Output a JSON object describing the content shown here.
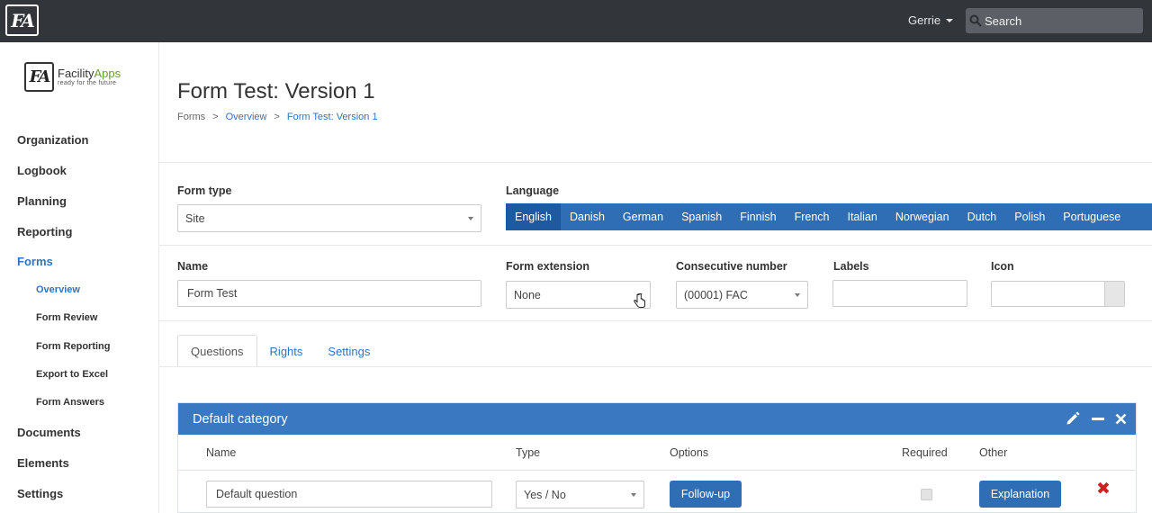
{
  "topbar": {
    "logo_text": "FA",
    "user_name": "Gerrie",
    "search_placeholder": "Search"
  },
  "brand": {
    "mark": "FA",
    "name_part1": "Facility",
    "name_part2": "Apps",
    "tagline": "ready for the future"
  },
  "sidebar": {
    "items": [
      {
        "label": "Organization"
      },
      {
        "label": "Logbook"
      },
      {
        "label": "Planning"
      },
      {
        "label": "Reporting"
      },
      {
        "label": "Forms"
      },
      {
        "label": "Documents"
      },
      {
        "label": "Elements"
      },
      {
        "label": "Settings"
      }
    ],
    "sub_items": [
      {
        "label": "Overview"
      },
      {
        "label": "Form Review"
      },
      {
        "label": "Form Reporting"
      },
      {
        "label": "Export to Excel"
      },
      {
        "label": "Form Answers"
      }
    ]
  },
  "page": {
    "title": "Form Test: Version 1",
    "breadcrumb": [
      "Forms",
      ">",
      "Overview",
      ">",
      "Form Test: Version 1"
    ]
  },
  "form": {
    "form_type_label": "Form type",
    "form_type_value": "Site",
    "language_label": "Language",
    "languages": [
      "English",
      "Danish",
      "German",
      "Spanish",
      "Finnish",
      "French",
      "Italian",
      "Norwegian",
      "Dutch",
      "Polish",
      "Portuguese"
    ],
    "name_label": "Name",
    "name_value": "Form Test",
    "extension_label": "Form extension",
    "extension_value": "None",
    "consecutive_label": "Consecutive number",
    "consecutive_value": "(00001) FAC",
    "labels_label": "Labels",
    "labels_value": "",
    "icon_label": "Icon"
  },
  "tabs": [
    "Questions",
    "Rights",
    "Settings"
  ],
  "category": {
    "title": "Default category",
    "icons": [
      "pencil-icon",
      "minus-icon",
      "close-icon"
    ],
    "columns": [
      "Name",
      "Type",
      "Options",
      "Required",
      "Other"
    ],
    "question": {
      "name": "Default question",
      "type": "Yes / No",
      "options_button": "Follow-up",
      "other_button": "Explanation",
      "delete_symbol": "✖"
    }
  },
  "colors": {
    "topbar": "#32363b",
    "accent": "#2f6db5",
    "link": "#2f74c0",
    "danger": "#cc2222"
  }
}
